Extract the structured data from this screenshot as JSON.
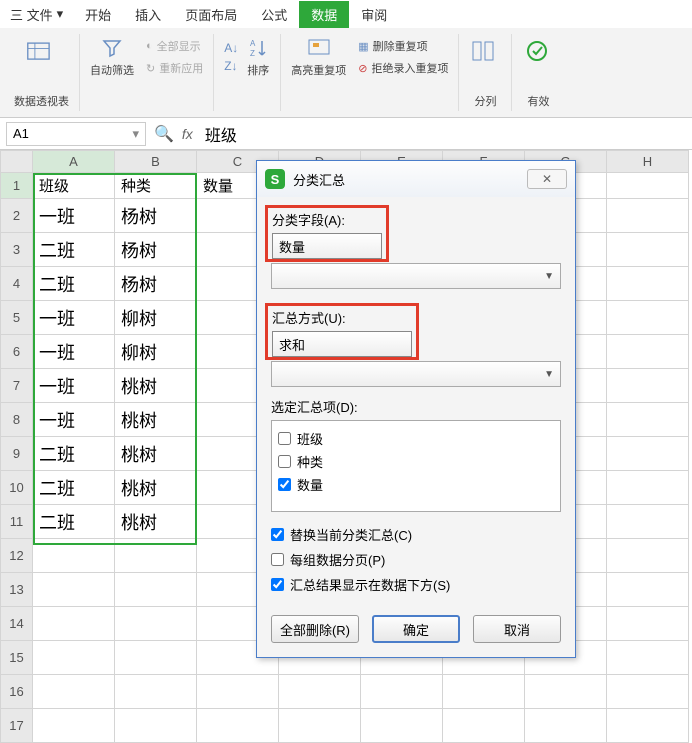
{
  "tabs": {
    "file": "三 文件",
    "begin": "开始",
    "insert": "插入",
    "layout": "页面布局",
    "formula": "公式",
    "data": "数据",
    "review": "审阅"
  },
  "toolbar": {
    "pivot": "数据透视表",
    "autofilter": "自动筛选",
    "showall": "全部显示",
    "reapply": "重新应用",
    "sort": "排序",
    "highlight_dup": "高亮重复项",
    "remove_dup": "删除重复项",
    "reject_dup": "拒绝录入重复项",
    "text_to_col": "分列",
    "validation": "有效"
  },
  "formula_bar": {
    "cell_ref": "A1",
    "fx": "fx",
    "value": "班级"
  },
  "columns": [
    "A",
    "B",
    "C",
    "D",
    "E",
    "F",
    "G",
    "H"
  ],
  "rows": [
    "1",
    "2",
    "3",
    "4",
    "5",
    "6",
    "7",
    "8",
    "9",
    "10",
    "11",
    "12",
    "13",
    "14",
    "15",
    "16",
    "17"
  ],
  "headers": {
    "c1": "班级",
    "c2": "种类",
    "c3": "数量"
  },
  "data_rows": [
    {
      "a": "一班",
      "b": "杨树"
    },
    {
      "a": "二班",
      "b": "杨树"
    },
    {
      "a": "二班",
      "b": "杨树"
    },
    {
      "a": "一班",
      "b": "柳树"
    },
    {
      "a": "一班",
      "b": "柳树"
    },
    {
      "a": "一班",
      "b": "桃树"
    },
    {
      "a": "一班",
      "b": "桃树"
    },
    {
      "a": "二班",
      "b": "桃树"
    },
    {
      "a": "二班",
      "b": "桃树"
    },
    {
      "a": "二班",
      "b": "桃树"
    }
  ],
  "dialog": {
    "title": "分类汇总",
    "field_label": "分类字段(A):",
    "field_value": "数量",
    "method_label": "汇总方式(U):",
    "method_value": "求和",
    "items_label": "选定汇总项(D):",
    "item1": "班级",
    "item2": "种类",
    "item3": "数量",
    "opt1": "替换当前分类汇总(C)",
    "opt2": "每组数据分页(P)",
    "opt3": "汇总结果显示在数据下方(S)",
    "btn_delete": "全部删除(R)",
    "btn_ok": "确定",
    "btn_cancel": "取消"
  }
}
